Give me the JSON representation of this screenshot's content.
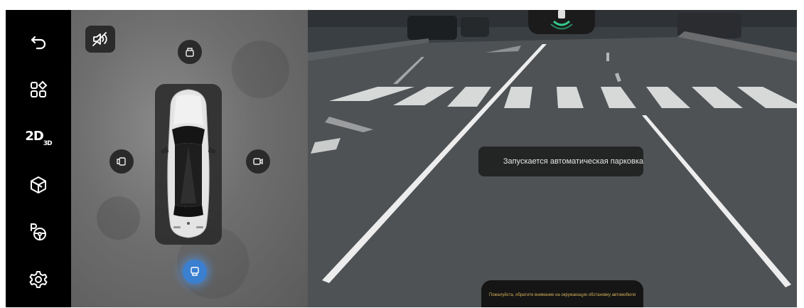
{
  "sidebar": {
    "items": [
      {
        "icon": "back-arrow-icon"
      },
      {
        "icon": "apps-grid-icon"
      },
      {
        "icon": "view-2d-3d-icon",
        "label_main": "2D",
        "label_sub": "3D"
      },
      {
        "icon": "cube-3d-icon"
      },
      {
        "icon": "parking-steering-icon"
      },
      {
        "icon": "settings-gear-icon"
      }
    ]
  },
  "surround_view": {
    "mute_icon": "sound-off-icon",
    "cameras": {
      "front": {
        "icon": "camera-front-icon"
      },
      "left": {
        "icon": "camera-left-icon"
      },
      "right": {
        "icon": "camera-right-icon"
      },
      "rear": {
        "icon": "camera-rear-icon",
        "active": true
      }
    },
    "car_color": "#e5e5e5"
  },
  "camera_view": {
    "status_toast": "Запускается автоматическая парковка",
    "bottom_notice": "Пожалуйста, обратите внимание на окружающую обстановку автомобиля"
  },
  "colors": {
    "accent_blue": "#3a7fd0",
    "notice_text": "#d7b25a",
    "sensor_green": "#35c98a"
  }
}
